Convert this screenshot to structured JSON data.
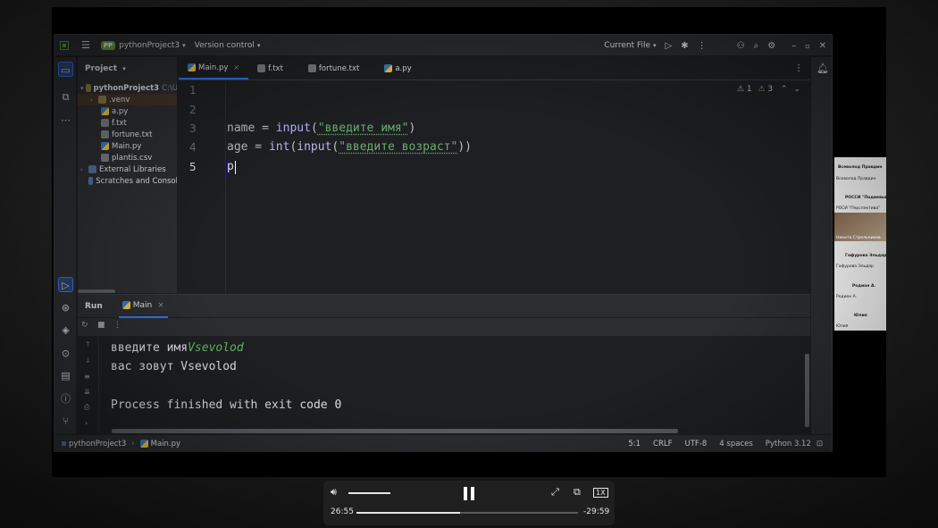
{
  "ide": {
    "project_badge": "PP",
    "project_name": "pythonProject3",
    "version_control": "Version control",
    "run_config": "Current File"
  },
  "project_panel": {
    "title": "Project",
    "items": [
      {
        "label": "pythonProject3",
        "suffix": "C:\\U"
      },
      {
        "label": ".venv"
      },
      {
        "label": "a.py"
      },
      {
        "label": "f.txt"
      },
      {
        "label": "fortune.txt"
      },
      {
        "label": "Main.py"
      },
      {
        "label": "plantis.csv"
      },
      {
        "label": "External Libraries"
      },
      {
        "label": "Scratches and Consol"
      }
    ]
  },
  "tabs": [
    {
      "label": "Main.py",
      "close": "×"
    },
    {
      "label": "f.txt"
    },
    {
      "label": "fortune.txt"
    },
    {
      "label": "a.py"
    }
  ],
  "editor": {
    "line_numbers": [
      "1",
      "2",
      "3",
      "4",
      "5"
    ],
    "inspections": {
      "warnings": "1",
      "weak": "3"
    },
    "lines": {
      "l3": {
        "a": "name = ",
        "fn": "input",
        "p1": "(",
        "s": "\"введите имя\"",
        "p2": ")"
      },
      "l4": {
        "a": "age = ",
        "f1": "int",
        "p1": "(",
        "fn": "input",
        "p2": "(",
        "s": "\"введите возраст\"",
        "p3": "))"
      },
      "l5": "p"
    }
  },
  "run": {
    "title": "Run",
    "tab": "Main",
    "close": "×",
    "output": {
      "line1_prompt": "введите имя",
      "line1_input": "Vsevolod",
      "line2": "вас зовут Vsevolod",
      "line3": "Process finished with exit code 0"
    }
  },
  "statusbar": {
    "project": "pythonProject3",
    "file": "Main.py",
    "position": "5:1",
    "line_sep": "CRLF",
    "encoding": "UTF-8",
    "indent": "4 spaces",
    "interpreter": "Python 3.12"
  },
  "participants": [
    {
      "text": "Всеволод Правдин",
      "bold": true
    },
    {
      "text": "Всеволод Правдин",
      "bold": false
    },
    {
      "text": "РОССИ \"Подиевый\" ...",
      "bold": true
    },
    {
      "text": "РОСИ \"Перспектива\"",
      "bold": false
    },
    {
      "text": "Никита Стрельников",
      "bold": false
    },
    {
      "text": "Гафурова Эльдар",
      "bold": true
    },
    {
      "text": "Гафурова Эльдар",
      "bold": false
    },
    {
      "text": "Родион А.",
      "bold": true
    },
    {
      "text": "Родион А.",
      "bold": false
    },
    {
      "text": "Юлия",
      "bold": true
    },
    {
      "text": "Юлия",
      "bold": false
    }
  ],
  "player": {
    "elapsed": "26:55",
    "remaining": "-29:59",
    "speed": "1X",
    "progress": 0.467,
    "volume": 0.75
  }
}
